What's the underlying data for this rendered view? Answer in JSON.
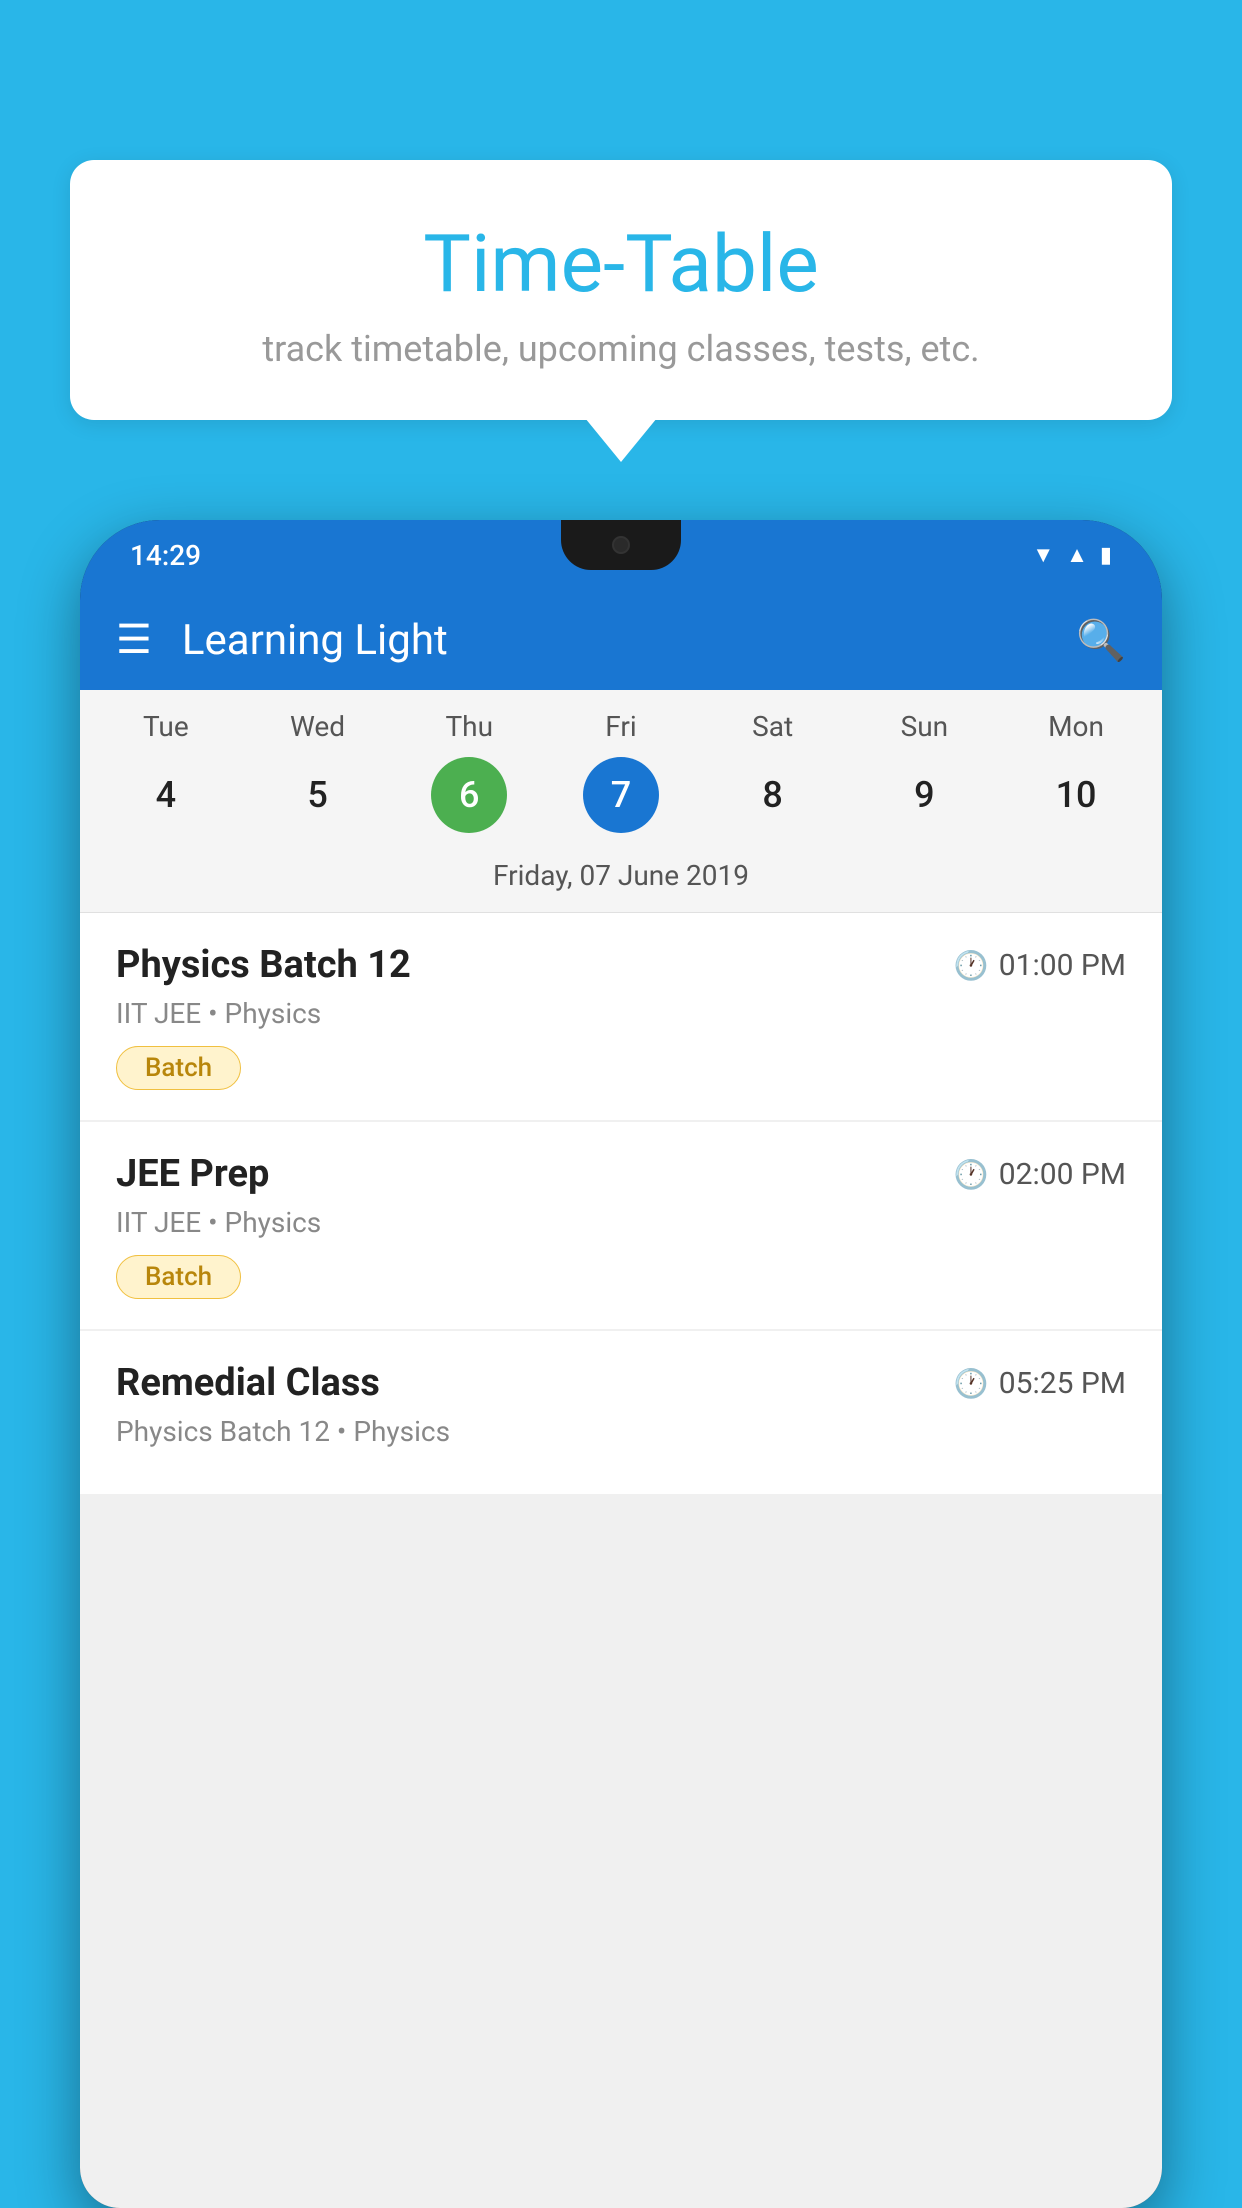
{
  "background_color": "#29B6E8",
  "speech_bubble": {
    "title": "Time-Table",
    "subtitle": "track timetable, upcoming classes, tests, etc."
  },
  "phone": {
    "status_bar": {
      "time": "14:29"
    },
    "app_bar": {
      "title": "Learning Light"
    },
    "calendar": {
      "days": [
        {
          "name": "Tue",
          "number": "4",
          "state": "normal"
        },
        {
          "name": "Wed",
          "number": "5",
          "state": "normal"
        },
        {
          "name": "Thu",
          "number": "6",
          "state": "today"
        },
        {
          "name": "Fri",
          "number": "7",
          "state": "selected"
        },
        {
          "name": "Sat",
          "number": "8",
          "state": "normal"
        },
        {
          "name": "Sun",
          "number": "9",
          "state": "normal"
        },
        {
          "name": "Mon",
          "number": "10",
          "state": "normal"
        }
      ],
      "selected_date_label": "Friday, 07 June 2019"
    },
    "schedule": [
      {
        "title": "Physics Batch 12",
        "time": "01:00 PM",
        "subtitle": "IIT JEE • Physics",
        "badge": "Batch"
      },
      {
        "title": "JEE Prep",
        "time": "02:00 PM",
        "subtitle": "IIT JEE • Physics",
        "badge": "Batch"
      },
      {
        "title": "Remedial Class",
        "time": "05:25 PM",
        "subtitle": "Physics Batch 12 • Physics",
        "badge": null
      }
    ]
  }
}
